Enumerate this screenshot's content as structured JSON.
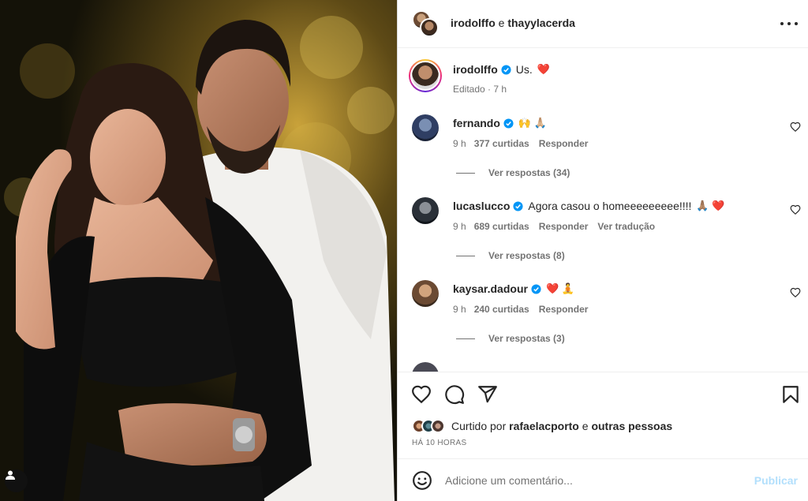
{
  "header": {
    "user1": "irodolffo",
    "joiner": "e",
    "user2": "thayylacerda"
  },
  "caption": {
    "username": "irodolffo",
    "text": "Us.",
    "emoji": "❤️",
    "meta": "Editado · 7 h"
  },
  "comments": [
    {
      "username": "fernando",
      "text": "",
      "emojis": "🙌 🙏🏼",
      "time": "9 h",
      "likes": "377 curtidas",
      "reply": "Responder",
      "translate": "",
      "view_replies": "Ver respostas (34)"
    },
    {
      "username": "lucaslucco",
      "text": "Agora casou o homeeeeeeeee!!!!",
      "emojis": "🙏🏽 ❤️",
      "time": "9 h",
      "likes": "689 curtidas",
      "reply": "Responder",
      "translate": "Ver tradução",
      "view_replies": "Ver respostas (8)"
    },
    {
      "username": "kaysar.dadour",
      "text": "",
      "emojis": "❤️ 🧘",
      "time": "9 h",
      "likes": "240 curtidas",
      "reply": "Responder",
      "translate": "",
      "view_replies": "Ver respostas (3)"
    }
  ],
  "likes": {
    "prefix": "Curtido por",
    "user": "rafaelacporto",
    "joiner": "e",
    "others": "outras pessoas"
  },
  "timeago": "HÁ 10 HORAS",
  "add_comment": {
    "placeholder": "Adicione um comentário...",
    "publish": "Publicar"
  },
  "colors": {
    "verified": "#0095f6",
    "publish_disabled": "#b2dffc",
    "heart": "#ed4956"
  },
  "icons": [
    "more-icon",
    "verified-icon",
    "heart-icon",
    "comment-icon",
    "share-icon",
    "bookmark-icon",
    "smile-icon",
    "user-tag-icon"
  ]
}
